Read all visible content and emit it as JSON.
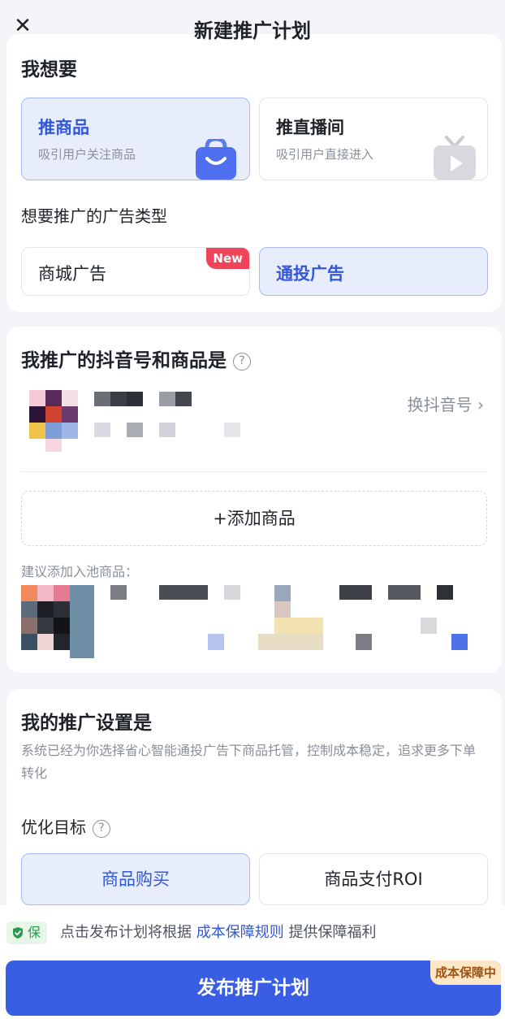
{
  "header": {
    "title": "新建推广计划",
    "close_icon": "close-icon"
  },
  "want": {
    "title": "我想要",
    "options": [
      {
        "title": "推商品",
        "desc": "吸引用户关注商品",
        "icon": "shopping-bag-icon",
        "selected": true
      },
      {
        "title": "推直播间",
        "desc": "吸引用户直接进入",
        "icon": "tv-icon",
        "selected": false
      }
    ],
    "ad_type_label": "想要推广的广告类型",
    "ad_types": [
      {
        "label": "商城广告",
        "badge": "New",
        "selected": false
      },
      {
        "label": "通投广告",
        "selected": true
      }
    ]
  },
  "account": {
    "title": "我推广的抖音号和商品是",
    "switch_label": "换抖音号",
    "add_product_label": "+添加商品",
    "suggest_label": "建议添加入池商品："
  },
  "settings": {
    "title": "我的推广设置是",
    "desc": "系统已经为你选择省心智能通投广告下商品托管，控制成本稳定，追求更多下单转化",
    "goal_label": "优化目标",
    "goals": [
      {
        "label": "商品购买",
        "selected": true
      },
      {
        "label": "商品支付ROI",
        "selected": false
      }
    ]
  },
  "footer": {
    "tag": "保",
    "notice_prefix": "点击发布计划将根据",
    "notice_link": "成本保障规则",
    "notice_suffix": "提供保障福利",
    "publish_label": "发布推广计划",
    "publish_badge": "成本保障中"
  },
  "colors": {
    "accent": "#3a5ee3",
    "selected_bg": "#e8edfc",
    "new_badge": "#f0445b",
    "guarantee_green": "#2b9a4c"
  }
}
